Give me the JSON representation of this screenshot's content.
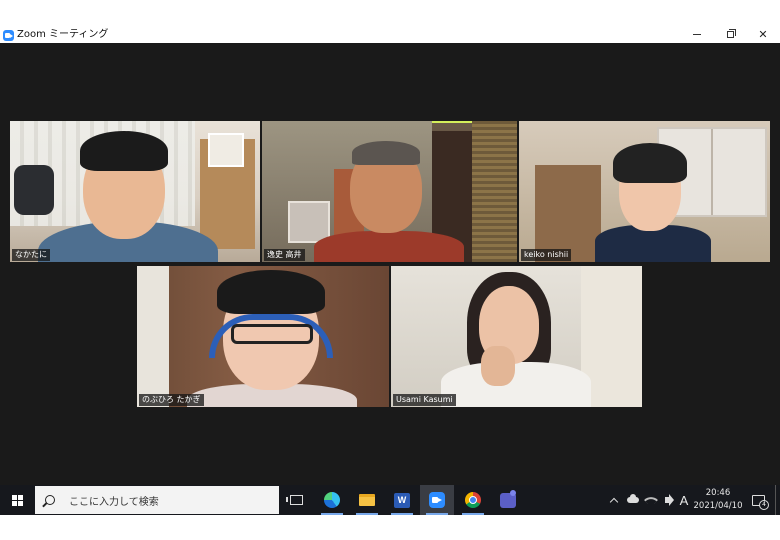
{
  "window": {
    "title": "Zoom ミーティング",
    "controls": {
      "minimize": "minimize",
      "maximize": "maximize",
      "close": "close"
    },
    "app_icon": "zoom-icon"
  },
  "meeting": {
    "participants": [
      {
        "name": "なかたに",
        "active_speaker": false
      },
      {
        "name": "逸史 高井",
        "active_speaker": true
      },
      {
        "name": "keiko nishii",
        "active_speaker": false
      },
      {
        "name": "のぶひろ たかぎ",
        "active_speaker": false
      },
      {
        "name": "Usami Kasumi",
        "active_speaker": false
      }
    ],
    "active_speaker_border_color": "#d4ef5b"
  },
  "taskbar": {
    "search_placeholder": "ここに入力して検索",
    "apps": [
      "task-view-icon",
      "edge-icon",
      "file-explorer-icon",
      "word-icon",
      "zoom-icon",
      "chrome-icon",
      "teams-icon"
    ],
    "ime_indicator": "A",
    "clock": {
      "time": "20:46",
      "date": "2021/04/10"
    },
    "notification_count": "4",
    "accent_color": "#78a8ea"
  }
}
